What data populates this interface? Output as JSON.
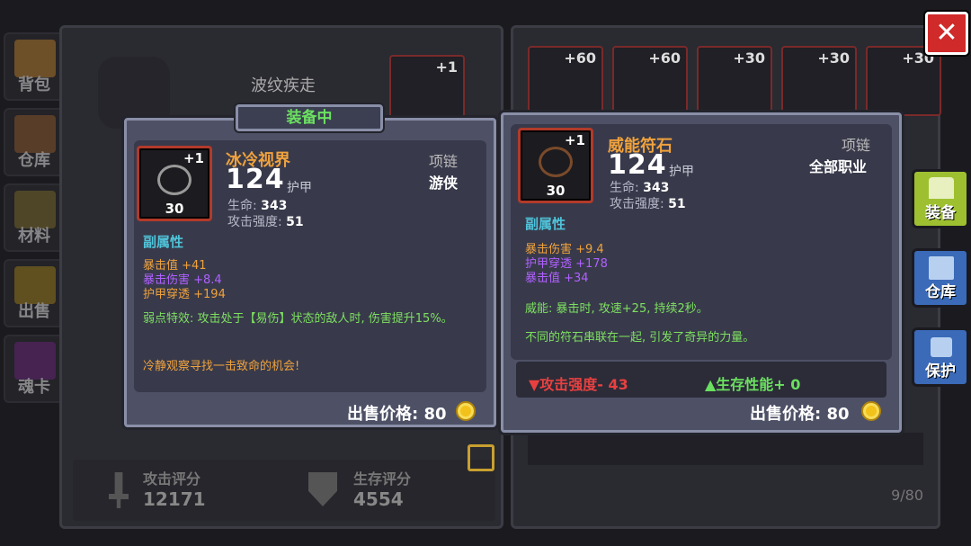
{
  "nav": [
    {
      "label": "背包"
    },
    {
      "label": "仓库"
    },
    {
      "label": "材料"
    },
    {
      "label": "出售"
    },
    {
      "label": "魂卡"
    }
  ],
  "left_panel": {
    "slot_title": "波纹疾走",
    "slot_plus": "+1",
    "attack_rating_label": "攻击评分",
    "attack_rating_value": "12171",
    "survival_rating_label": "生存评分",
    "survival_rating_value": "4554"
  },
  "right_panel": {
    "slots": [
      {
        "plus": "+60"
      },
      {
        "plus": "+60"
      },
      {
        "plus": "+30"
      },
      {
        "plus": "+30"
      },
      {
        "plus": "+30"
      }
    ],
    "count": "9/80"
  },
  "equipped_card": {
    "header": "装备中",
    "icon_plus": "+1",
    "icon_level": "30",
    "name": "冰冷视界",
    "armor_value": "124",
    "armor_label": "护甲",
    "type": "项链",
    "class": "游侠",
    "stat1_label": "生命:",
    "stat1_value": "343",
    "stat2_label": "攻击强度:",
    "stat2_value": "51",
    "sub_header": "副属性",
    "affixes": [
      {
        "text": "暴击值 +41",
        "color": "#f0a23c"
      },
      {
        "text": "暴击伤害 +8.4",
        "color": "#b060ff"
      },
      {
        "text": "护甲穿透 +194",
        "color": "#f0a23c"
      }
    ],
    "special": "弱点特效: 攻击处于【易伤】状态的敌人时, 伤害提升15%。",
    "flavor": "冷静观察寻找一击致命的机会!",
    "price_label": "出售价格: 80"
  },
  "compare_card": {
    "icon_plus": "+1",
    "icon_level": "30",
    "name": "威能符石",
    "armor_value": "124",
    "armor_label": "护甲",
    "type": "项链",
    "class": "全部职业",
    "stat1_label": "生命:",
    "stat1_value": "343",
    "stat2_label": "攻击强度:",
    "stat2_value": "51",
    "sub_header": "副属性",
    "affixes": [
      {
        "text": "暴击伤害 +9.4",
        "color": "#f0a23c"
      },
      {
        "text": "护甲穿透 +178",
        "color": "#b060ff"
      },
      {
        "text": "暴击值 +34",
        "color": "#b060ff"
      }
    ],
    "special": "威能: 暴击时, 攻速+25, 持续2秒。",
    "flavor": "不同的符石串联在一起, 引发了奇异的力量。",
    "diff_attack": "▼攻击强度- 43",
    "diff_survival": "▲生存性能+ 0",
    "price_label": "出售价格: 80"
  },
  "right_buttons": [
    {
      "label": "装备"
    },
    {
      "label": "仓库"
    },
    {
      "label": "保护"
    }
  ],
  "close_label": "✕"
}
